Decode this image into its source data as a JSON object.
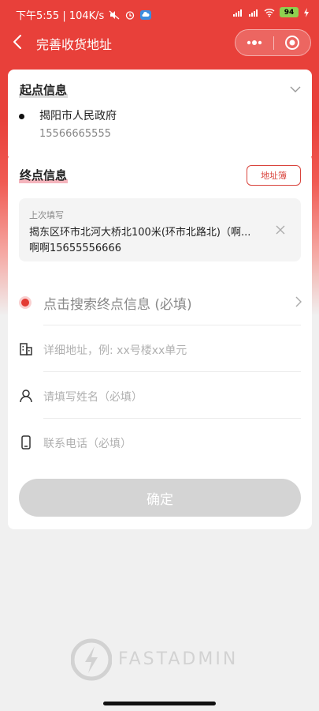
{
  "status_bar": {
    "time_net": "下午5:55 | 104K/s",
    "battery": "94"
  },
  "navbar": {
    "title": "完善收货地址"
  },
  "start_section": {
    "title": "起点信息",
    "name": "揭阳市人民政府",
    "phone": "15566665555"
  },
  "end_section": {
    "title": "终点信息",
    "address_book_button": "地址簿",
    "last_fill": {
      "label": "上次填写",
      "address": "揭东区环市北河大桥北100米(环市北路北)（啊...",
      "phone": "啊啊15655556666"
    },
    "search_placeholder": "点击搜索终点信息 (必填)",
    "detail_placeholder": "详细地址，例: xx号楼xx单元",
    "name_placeholder": "请填写姓名（必填）",
    "phone_placeholder": "联系电话（必填）",
    "confirm_button": "确定"
  },
  "watermark": {
    "text": "FASTADMIN"
  },
  "colors": {
    "brand_red": "#e8403a",
    "accent_red": "#d9443d",
    "button_disabled": "#d4d4d4"
  },
  "icons": {
    "back": "chevron-left-icon",
    "more": "more-dots-icon",
    "target": "target-circle-icon",
    "expand": "chevron-down-icon",
    "close": "close-icon",
    "building": "building-icon",
    "user": "user-icon",
    "phone": "phone-icon"
  }
}
